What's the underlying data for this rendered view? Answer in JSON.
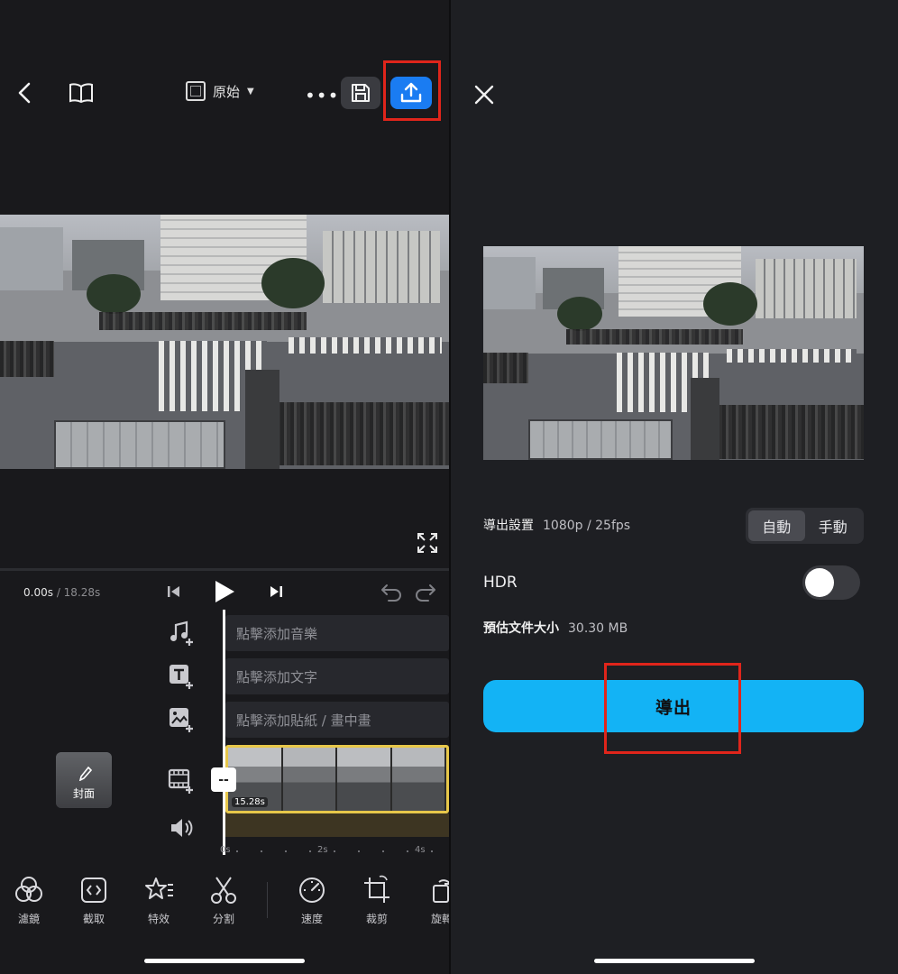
{
  "left": {
    "topbar": {
      "back_icon": "chevron-left-icon",
      "book_icon": "book-icon",
      "ratio_label": "原始",
      "more_icon": "more-horizontal-icon",
      "save_icon": "save-disk-icon",
      "export_icon": "upload-icon"
    },
    "timeline": {
      "current_time": "0.00s",
      "total_time": "/ 18.28s",
      "tracks": {
        "music": "點擊添加音樂",
        "text": "點擊添加文字",
        "sticker": "點擊添加貼紙 / 畫中畫"
      },
      "clip_length": "15.28s",
      "split_handle": "--",
      "ruler_ticks": [
        "0s",
        "2s",
        "4s"
      ],
      "cover_label": "封面"
    },
    "toolbar": [
      {
        "label": "濾鏡",
        "icon": "filter-circles-icon"
      },
      {
        "label": "截取",
        "icon": "trim-icon"
      },
      {
        "label": "特效",
        "icon": "star-effects-icon"
      },
      {
        "label": "分割",
        "icon": "scissors-icon"
      },
      {
        "label": "速度",
        "icon": "speedometer-icon"
      },
      {
        "label": "裁剪",
        "icon": "crop-icon"
      },
      {
        "label": "旋轉",
        "icon": "rotate-icon"
      }
    ]
  },
  "right": {
    "close_icon": "close-icon",
    "settings_label": "導出設置",
    "settings_value": "1080p / 25fps",
    "mode_options": [
      "自動",
      "手動"
    ],
    "mode_selected": "自動",
    "hdr_label": "HDR",
    "hdr_enabled": false,
    "size_label": "預估文件大小",
    "size_value": "30.30 MB",
    "export_label": "導出"
  },
  "colors": {
    "accent_blue": "#1a7cf2",
    "export_cyan": "#13b3f5",
    "highlight_red": "#e0251b",
    "clip_border": "#e7c74a"
  }
}
